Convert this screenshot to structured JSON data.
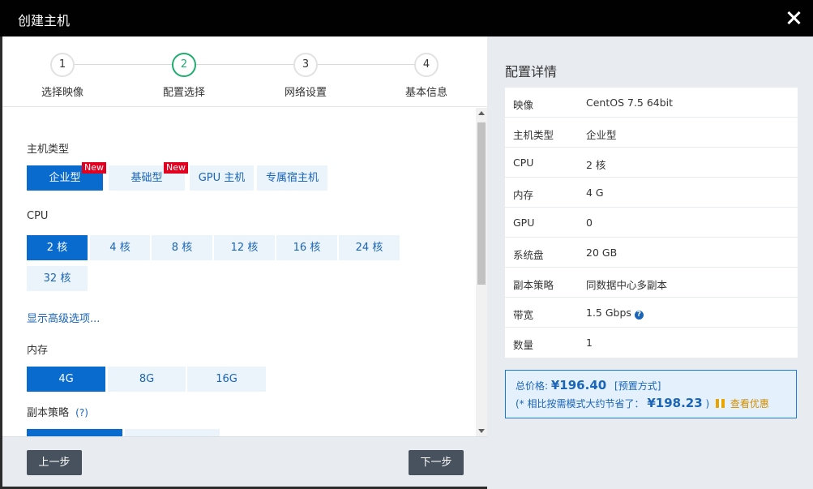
{
  "window": {
    "title": "创建主机"
  },
  "steps": [
    {
      "num": "1",
      "label": "选择映像"
    },
    {
      "num": "2",
      "label": "配置选择"
    },
    {
      "num": "3",
      "label": "网络设置"
    },
    {
      "num": "4",
      "label": "基本信息"
    }
  ],
  "form": {
    "host_type_label": "主机类型",
    "host_types": [
      "企业型",
      "基础型",
      "GPU 主机",
      "专属宿主机"
    ],
    "new_badge": "New",
    "cpu_label": "CPU",
    "cpu_options": [
      "2 核",
      "4 核",
      "8 核",
      "12 核",
      "16 核",
      "24 核",
      "32 核"
    ],
    "advanced_link": "显示高级选项...",
    "memory_label": "内存",
    "memory_options": [
      "4G",
      "8G",
      "16G"
    ],
    "replica_label": "副本策略",
    "replica_help": "(?)"
  },
  "footer": {
    "prev": "上一步",
    "next": "下一步"
  },
  "detail": {
    "title": "配置详情",
    "rows": [
      {
        "k": "映像",
        "v": "CentOS 7.5 64bit"
      },
      {
        "k": "主机类型",
        "v": "企业型"
      },
      {
        "k": "CPU",
        "v": "2 核"
      },
      {
        "k": "内存",
        "v": "4 G"
      },
      {
        "k": "GPU",
        "v": "0"
      },
      {
        "k": "系统盘",
        "v": "20 GB"
      },
      {
        "k": "副本策略",
        "v": "同数据中心多副本"
      },
      {
        "k": "带宽",
        "v": "1.5 Gbps"
      },
      {
        "k": "数量",
        "v": "1"
      }
    ],
    "help_glyph": "?"
  },
  "price": {
    "total_label": "总价格:",
    "total": "¥196.40",
    "mode": "[预置方式]",
    "save_prefix": "(* 相比按需模式大约节省了：",
    "save_amount": "¥198.23",
    "save_suffix": ")",
    "discount_link": "查看优惠"
  },
  "colors": {
    "accent": "#0a6bcf",
    "step_active": "#1fad6f",
    "titlebar": "#010101",
    "new_badge": "#e1001f"
  }
}
